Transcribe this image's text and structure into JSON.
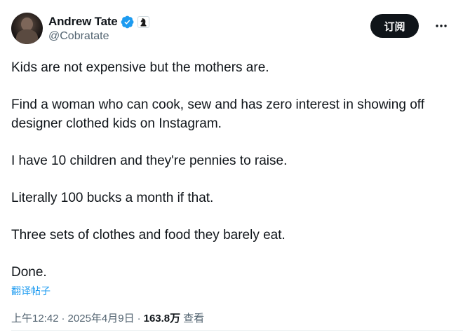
{
  "author": {
    "display_name": "Andrew Tate",
    "handle": "@Cobratate",
    "avatar_icon": "profile-photo",
    "verified_icon": "verified-badge-icon",
    "affiliate_icon": "chess-knight-icon"
  },
  "actions": {
    "subscribe_label": "订阅",
    "more_icon": "more-dots-icon"
  },
  "tweet": {
    "paragraphs": [
      "Kids are not expensive but the mothers are.",
      "Find a woman who can cook, sew and has zero interest in showing off designer clothed kids on Instagram.",
      "I have 10 children and they're pennies to raise.",
      "Literally 100 bucks a month if that.",
      "Three sets of clothes and food they barely eat.",
      "Done."
    ],
    "translate_label": "翻译帖子"
  },
  "meta": {
    "time": "上午12:42",
    "separator": "·",
    "date": "2025年4月9日",
    "views_count": "163.8万",
    "views_label": "查看"
  },
  "colors": {
    "text": "#0f1419",
    "secondary": "#536471",
    "link": "#1d9bf0",
    "verified": "#1d9bf0",
    "button_bg": "#0f1419"
  }
}
